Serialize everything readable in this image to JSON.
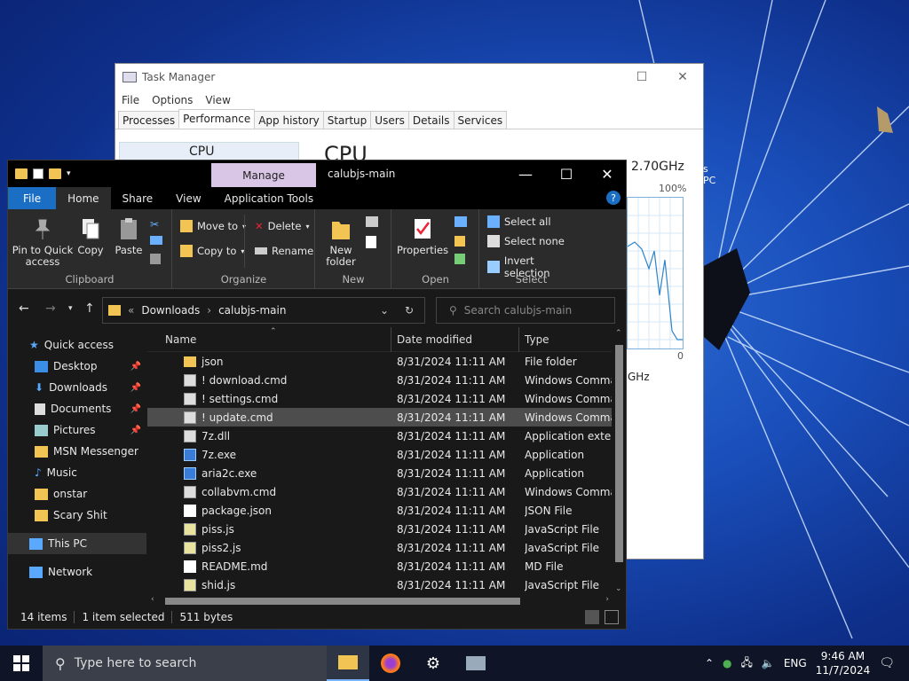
{
  "task_manager": {
    "title": "Task Manager",
    "menu": [
      "File",
      "Options",
      "View"
    ],
    "tabs": [
      "Processes",
      "Performance",
      "App history",
      "Startup",
      "Users",
      "Details",
      "Services"
    ],
    "cpu_thumb_label": "CPU",
    "cpu_heading": "CPU",
    "speed": "2.70GHz",
    "pc_label": "s PC",
    "percent_max": "100%",
    "percent_min": "0",
    "speed_small": "GHz"
  },
  "explorer": {
    "title": "calubjs-main",
    "manage_tab": "Manage",
    "ribbon_tabs": [
      "File",
      "Home",
      "Share",
      "View",
      "Application Tools"
    ],
    "clipboard": {
      "pin": "Pin to Quick access",
      "copy": "Copy",
      "paste": "Paste",
      "label": "Clipboard"
    },
    "organize": {
      "move_to": "Move to",
      "copy_to": "Copy to",
      "delete": "Delete",
      "rename": "Rename",
      "label": "Organize"
    },
    "new": {
      "new_folder": "New folder",
      "label": "New"
    },
    "open": {
      "properties": "Properties",
      "label": "Open"
    },
    "select": {
      "select_all": "Select all",
      "select_none": "Select none",
      "invert": "Invert selection",
      "label": "Select"
    },
    "address": {
      "crumb_prefix": "«",
      "crumb1": "Downloads",
      "crumb2": "calubjs-main"
    },
    "search_placeholder": "Search calubjs-main",
    "nav": {
      "quick_access": "Quick access",
      "desktop": "Desktop",
      "downloads": "Downloads",
      "documents": "Documents",
      "pictures": "Pictures",
      "msn": "MSN Messenger",
      "music": "Music",
      "onstar": "onstar",
      "scary": "Scary Shit",
      "this_pc": "This PC",
      "network": "Network"
    },
    "columns": {
      "name": "Name",
      "date": "Date modified",
      "type": "Type"
    },
    "files": [
      {
        "name": "json",
        "date": "8/31/2024 11:11 AM",
        "type": "File folder",
        "kind": "fold"
      },
      {
        "name": "! download.cmd",
        "date": "8/31/2024 11:11 AM",
        "type": "Windows Comma...",
        "kind": "cmd"
      },
      {
        "name": "! settings.cmd",
        "date": "8/31/2024 11:11 AM",
        "type": "Windows Comma...",
        "kind": "cmd"
      },
      {
        "name": "! update.cmd",
        "date": "8/31/2024 11:11 AM",
        "type": "Windows Comma...",
        "kind": "cmd"
      },
      {
        "name": "7z.dll",
        "date": "8/31/2024 11:11 AM",
        "type": "Application exten...",
        "kind": "cmd"
      },
      {
        "name": "7z.exe",
        "date": "8/31/2024 11:11 AM",
        "type": "Application",
        "kind": "app"
      },
      {
        "name": "aria2c.exe",
        "date": "8/31/2024 11:11 AM",
        "type": "Application",
        "kind": "app"
      },
      {
        "name": "collabvm.cmd",
        "date": "8/31/2024 11:11 AM",
        "type": "Windows Comma...",
        "kind": "cmd"
      },
      {
        "name": "package.json",
        "date": "8/31/2024 11:11 AM",
        "type": "JSON File",
        "kind": "doc"
      },
      {
        "name": "piss.js",
        "date": "8/31/2024 11:11 AM",
        "type": "JavaScript File",
        "kind": "js"
      },
      {
        "name": "piss2.js",
        "date": "8/31/2024 11:11 AM",
        "type": "JavaScript File",
        "kind": "js"
      },
      {
        "name": "README.md",
        "date": "8/31/2024 11:11 AM",
        "type": "MD File",
        "kind": "doc"
      },
      {
        "name": "shid.js",
        "date": "8/31/2024 11:11 AM",
        "type": "JavaScript File",
        "kind": "js"
      }
    ],
    "status": {
      "items": "14 items",
      "selected": "1 item selected",
      "size": "511 bytes"
    }
  },
  "taskbar": {
    "search_placeholder": "Type here to search",
    "lang": "ENG",
    "time": "9:46 AM",
    "date": "11/7/2024"
  }
}
